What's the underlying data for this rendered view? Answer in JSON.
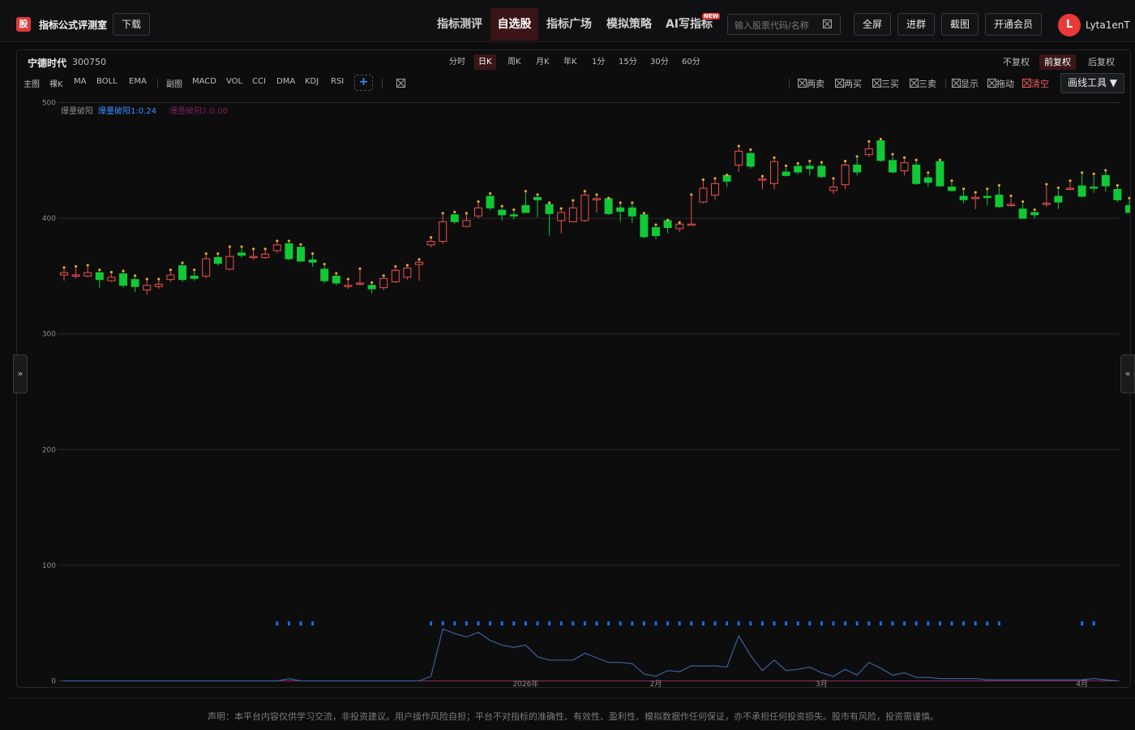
{
  "header": {
    "logo_char": "股",
    "app_title": "指标公式评测室",
    "download_label": "下载",
    "nav_tabs": [
      "指标测评",
      "自选股",
      "指标广场",
      "模拟策略",
      "AI写指标"
    ],
    "active_tab": "自选股",
    "new_badge": "NEW",
    "search_placeholder": "输入股票代码/名称",
    "buttons": [
      "全屏",
      "进群",
      "截图",
      "开通会员"
    ],
    "avatar_letter": "L",
    "username": "Lyta1enT"
  },
  "chart_panel": {
    "stock_name": "宁德时代",
    "stock_code": "300750",
    "periods": [
      "分时",
      "日K",
      "周K",
      "月K",
      "年K",
      "1分",
      "15分",
      "30分",
      "60分"
    ],
    "active_period": "日K",
    "adjust_modes": [
      "不复权",
      "前复权",
      "后复权"
    ],
    "active_adjust": "前复权",
    "main_label": "主图",
    "main_indicators": [
      "裸K",
      "MA",
      "BOLL",
      "EMA"
    ],
    "sub_label": "副图",
    "sub_indicators": [
      "MACD",
      "VOL",
      "CCI",
      "DMA",
      "KDJ",
      "RSI"
    ],
    "plus_label": "+",
    "tool_checks": [
      {
        "label": "两卖",
        "color": "#bdbdbd"
      },
      {
        "label": "两买",
        "color": "#bdbdbd"
      },
      {
        "label": "三买",
        "color": "#bdbdbd"
      },
      {
        "label": "三卖",
        "color": "#bdbdbd"
      },
      {
        "label": "显示",
        "color": "#bdbdbd"
      },
      {
        "label": "拖动",
        "color": "#bdbdbd"
      },
      {
        "label": "清空",
        "color": "#e85a5a"
      }
    ],
    "draw_tools_label": "画线工具 ▼",
    "side_left": "»",
    "side_right": "«"
  },
  "chart_data": {
    "type": "candlestick",
    "ylim": [
      0,
      500
    ],
    "yticks": [
      0,
      100,
      200,
      300,
      400,
      500
    ],
    "x_labels": [
      {
        "index": 39,
        "label": "2026年"
      },
      {
        "index": 50,
        "label": "2月"
      },
      {
        "index": 64,
        "label": "3月"
      },
      {
        "index": 86,
        "label": "4月"
      }
    ],
    "legend": [
      {
        "label": "爆量破阳",
        "color": "#8a8a8a"
      },
      {
        "label": "爆量破阳1:0.24",
        "color": "#3b8cff"
      },
      {
        "label": "爆量破阳2:0.00",
        "color": "#7a1f5a"
      }
    ],
    "colors": {
      "up": "#f0504a",
      "down": "#11c934",
      "marker": "#e8a92a",
      "line": "#3e5e9a",
      "dots": "#1a6ee8",
      "base": "#8a2a66"
    },
    "candles": [
      [
        351,
        353,
        356,
        346
      ],
      [
        350,
        351,
        357,
        348
      ],
      [
        350,
        353,
        358,
        349
      ],
      [
        353,
        347,
        354,
        340
      ],
      [
        346,
        349,
        352,
        345
      ],
      [
        352,
        342,
        353,
        340
      ],
      [
        347,
        341,
        349,
        336
      ],
      [
        338,
        342,
        346,
        334
      ],
      [
        341,
        343,
        346,
        339
      ],
      [
        347,
        351,
        354,
        345
      ],
      [
        359,
        347,
        360,
        345
      ],
      [
        350,
        348,
        354,
        346
      ],
      [
        350,
        365,
        368,
        348
      ],
      [
        366,
        361,
        368,
        359
      ],
      [
        356,
        367,
        374,
        355
      ],
      [
        370,
        368,
        374,
        366
      ],
      [
        367,
        367,
        372,
        364
      ],
      [
        366,
        369,
        372,
        365
      ],
      [
        372,
        377,
        379,
        370
      ],
      [
        378,
        365,
        379,
        364
      ],
      [
        375,
        363,
        376,
        362
      ],
      [
        364,
        362,
        368,
        358
      ],
      [
        356,
        346,
        359,
        344
      ],
      [
        350,
        344,
        351,
        342
      ],
      [
        342,
        342,
        346,
        339
      ],
      [
        344,
        344,
        355,
        342
      ],
      [
        342,
        339,
        343,
        335
      ],
      [
        340,
        348,
        349,
        338
      ],
      [
        345,
        355,
        357,
        344
      ],
      [
        349,
        357,
        358,
        347
      ],
      [
        360,
        362,
        363,
        346
      ],
      [
        377,
        380,
        382,
        375
      ],
      [
        380,
        397,
        403,
        378
      ],
      [
        403,
        397,
        404,
        395
      ],
      [
        393,
        398,
        403,
        392
      ],
      [
        402,
        409,
        413,
        400
      ],
      [
        419,
        409,
        420,
        407
      ],
      [
        407,
        403,
        409,
        398
      ],
      [
        403,
        402,
        406,
        399
      ],
      [
        411,
        405,
        422,
        405
      ],
      [
        418,
        416,
        419,
        401
      ],
      [
        412,
        404,
        412,
        385
      ],
      [
        398,
        405,
        407,
        387
      ],
      [
        397,
        409,
        414,
        398
      ],
      [
        398,
        420,
        422,
        397
      ],
      [
        417,
        417,
        419,
        405
      ],
      [
        417,
        404,
        416,
        403
      ],
      [
        409,
        406,
        412,
        397
      ],
      [
        409,
        402,
        412,
        396
      ],
      [
        403,
        384,
        403,
        383
      ],
      [
        392,
        385,
        393,
        382
      ],
      [
        398,
        392,
        397,
        387
      ],
      [
        391,
        395,
        395,
        388
      ],
      [
        394,
        395,
        419,
        394
      ],
      [
        414,
        426,
        432,
        413
      ],
      [
        420,
        430,
        433,
        416
      ],
      [
        437,
        432,
        436,
        427
      ],
      [
        446,
        458,
        461,
        440
      ],
      [
        456,
        445,
        458,
        443
      ],
      [
        434,
        434,
        435,
        425
      ],
      [
        430,
        449,
        451,
        425
      ],
      [
        440,
        437,
        444,
        436
      ],
      [
        445,
        440,
        446,
        438
      ],
      [
        445,
        443,
        448,
        437
      ],
      [
        445,
        436,
        447,
        435
      ],
      [
        424,
        427,
        433,
        421
      ],
      [
        429,
        446,
        448,
        425
      ],
      [
        446,
        440,
        452,
        437
      ],
      [
        455,
        460,
        465,
        453
      ],
      [
        467,
        450,
        467,
        449
      ],
      [
        450,
        440,
        454,
        439
      ],
      [
        441,
        448,
        451,
        437
      ],
      [
        446,
        430,
        449,
        429
      ],
      [
        435,
        431,
        438,
        427
      ],
      [
        449,
        428,
        449,
        427
      ],
      [
        427,
        424,
        431,
        423
      ],
      [
        419,
        416,
        424,
        413
      ],
      [
        418,
        418,
        421,
        408
      ],
      [
        419,
        418,
        424,
        411
      ],
      [
        420,
        410,
        427,
        409
      ],
      [
        412,
        412,
        418,
        410
      ],
      [
        408,
        400,
        413,
        400
      ],
      [
        405,
        403,
        406,
        400
      ],
      [
        413,
        413,
        428,
        410
      ],
      [
        419,
        414,
        425,
        408
      ],
      [
        425,
        426,
        431,
        424
      ],
      [
        428,
        419,
        438,
        418
      ],
      [
        427,
        426,
        437,
        422
      ],
      [
        437,
        428,
        440,
        423
      ],
      [
        425,
        416,
        427,
        414
      ],
      [
        411,
        405,
        416,
        405
      ]
    ],
    "volume_line": [
      0,
      0,
      0,
      0,
      0,
      0,
      0,
      0,
      0,
      0,
      0,
      0,
      0,
      0,
      0,
      0,
      0,
      0,
      0,
      2,
      0,
      0,
      0,
      0,
      0,
      0,
      0,
      0,
      0,
      0,
      0,
      4,
      45,
      41,
      38,
      42,
      35,
      31,
      29,
      31,
      21,
      18,
      18,
      18,
      24,
      20,
      16,
      16,
      15,
      6,
      4,
      9,
      8,
      13,
      13,
      13,
      12,
      39,
      22,
      9,
      18,
      9,
      10,
      12,
      7,
      4,
      10,
      5,
      16,
      11,
      5,
      7,
      3,
      3,
      2,
      2,
      2,
      2,
      1,
      1,
      1,
      1,
      1,
      1,
      1,
      1,
      1,
      2,
      1,
      0
    ],
    "signal_dots": [
      {
        "from": 18,
        "to": 21
      },
      {
        "from": 31,
        "to": 79
      },
      {
        "from": 86,
        "to": 87
      }
    ]
  },
  "footer": {
    "disclaimer": "声明：本平台内容仅供学习交流，非投资建议。用户操作风险自担；平台不对指标的准确性、有效性、盈利性、模拟数据作任何保证，亦不承担任何投资损失。股市有风险，投资需谨慎。"
  }
}
